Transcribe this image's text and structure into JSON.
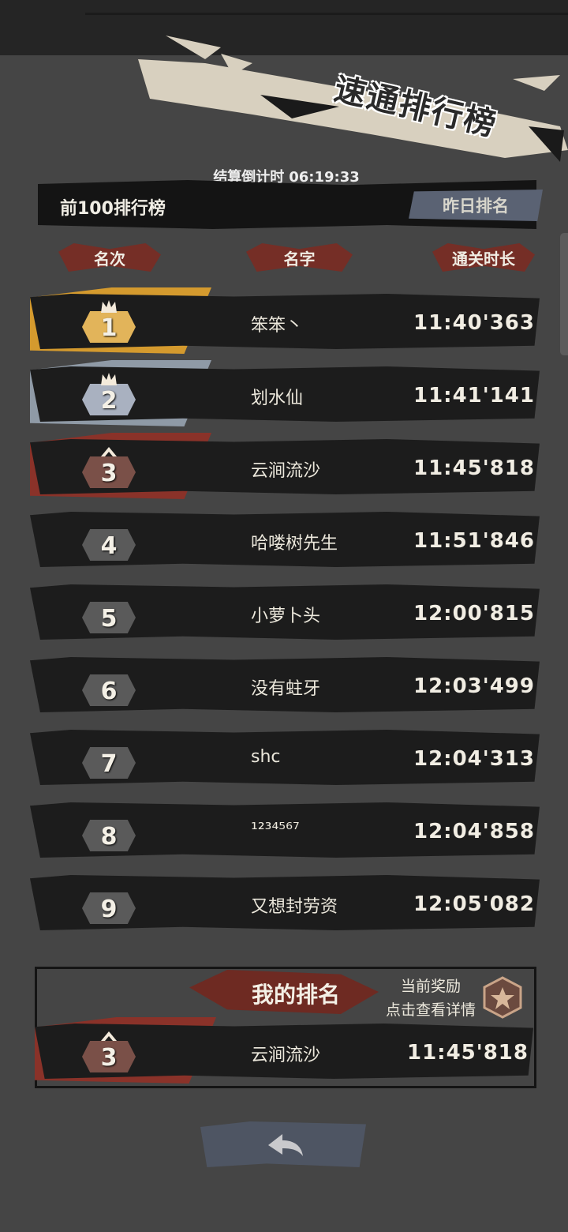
{
  "title": "速通排行榜",
  "countdown": {
    "label": "结算倒计时",
    "value": "06:19:33"
  },
  "tabs": {
    "current": "前100排行榜",
    "yesterday": "昨日排名"
  },
  "columns": {
    "rank": "名次",
    "name": "名字",
    "time": "通关时长"
  },
  "rows": [
    {
      "rank": "1",
      "name": "笨笨丶",
      "time": "11:40'363"
    },
    {
      "rank": "2",
      "name": "划水仙",
      "time": "11:41'141"
    },
    {
      "rank": "3",
      "name": "云涧流沙",
      "time": "11:45'818"
    },
    {
      "rank": "4",
      "name": "哈喽树先生",
      "time": "11:51'846"
    },
    {
      "rank": "5",
      "name": "小萝卜头",
      "time": "12:00'815"
    },
    {
      "rank": "6",
      "name": "没有蛀牙",
      "time": "12:03'499"
    },
    {
      "rank": "7",
      "name": "shc",
      "time": "12:04'313"
    },
    {
      "rank": "8",
      "name": "¹²³⁴⁵⁶⁷",
      "time": "12:04'858"
    },
    {
      "rank": "9",
      "name": "又想封劳资",
      "time": "12:05'082"
    }
  ],
  "my_rank": {
    "title": "我的排名",
    "reward_line1": "当前奖励",
    "reward_line2": "点击查看详情",
    "rank": "3",
    "name": "云涧流沙",
    "time": "11:45'818"
  },
  "colors": {
    "gold": "#d49a2e",
    "silver": "#8f9aa6",
    "bronze": "#8a3229",
    "plain": "#5a5a5a"
  },
  "icons": [
    "crown-icon",
    "reward-medal-icon",
    "back-arrow-icon"
  ]
}
